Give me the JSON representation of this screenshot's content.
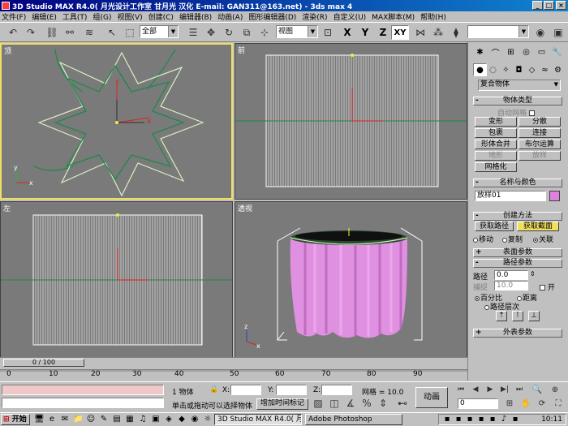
{
  "window": {
    "title": "3D Studio MAX R4.0( 月光设计工作室 甘月光 汉化  E-mail: GAN311@163.net) - 3ds max 4"
  },
  "menu": [
    "文件(F)",
    "编辑(E)",
    "工具(T)",
    "组(G)",
    "视图(V)",
    "创建(C)",
    "编辑器(B)",
    "动画(A)",
    "图形编辑器(D)",
    "渲染(R)",
    "自定义(U)",
    "MAX脚本(M)",
    "帮助(H)"
  ],
  "toolbar": {
    "selection_filter": "全部",
    "coord_system": "视图",
    "axis_x": "X",
    "axis_y": "Y",
    "axis_z": "Z",
    "axis_xy": "XY"
  },
  "viewports": {
    "top": "顶",
    "front": "前",
    "left": "左",
    "persp": "透视"
  },
  "command_panel": {
    "category": "复合物体",
    "object_type": {
      "title": "物体类型",
      "autogrid": "自动网格",
      "buttons": [
        "变形",
        "分散",
        "包裹",
        "连接",
        "形体合并",
        "布尔运算",
        "地形",
        "放样",
        "网格化"
      ]
    },
    "name_color": {
      "title": "名称与颜色",
      "name": "放样01",
      "color": "#e080e0"
    },
    "creation": {
      "title": "创建方法",
      "get_path": "获取路径",
      "get_shape": "获取截面",
      "move": "移动",
      "copy": "复制",
      "instance": "关联"
    },
    "surface": {
      "title": "表面参数"
    },
    "path": {
      "title": "路径参数",
      "path_label": "路径",
      "path_value": "0.0",
      "snap_label": "捕捉",
      "snap_value": "10.0",
      "on_label": "开",
      "percent": "百分比",
      "distance": "距离",
      "path_steps": "路径层次"
    },
    "skin": {
      "title": "外表参数"
    }
  },
  "timeline": {
    "frame": "0 / 100",
    "ticks": [
      "0",
      "10",
      "20",
      "30",
      "40",
      "50",
      "60",
      "70",
      "80",
      "90"
    ]
  },
  "status": {
    "selected": "1 物体",
    "x_label": "X:",
    "y_label": "Y:",
    "z_label": "Z:",
    "grid_label": "网格 = 10.0",
    "prompt": "单击或拖动可以选择物体",
    "add_time_tag": "增加时间标记",
    "animate": "动画",
    "frame": "0"
  },
  "taskbar": {
    "start": "开始",
    "tasks": [
      "3D Studio MAX R4.0( 月",
      "Adobe Photoshop"
    ],
    "clock": "10:11"
  },
  "colors": {
    "loft_object": "#e090e0",
    "active_border": "#f0e060"
  }
}
